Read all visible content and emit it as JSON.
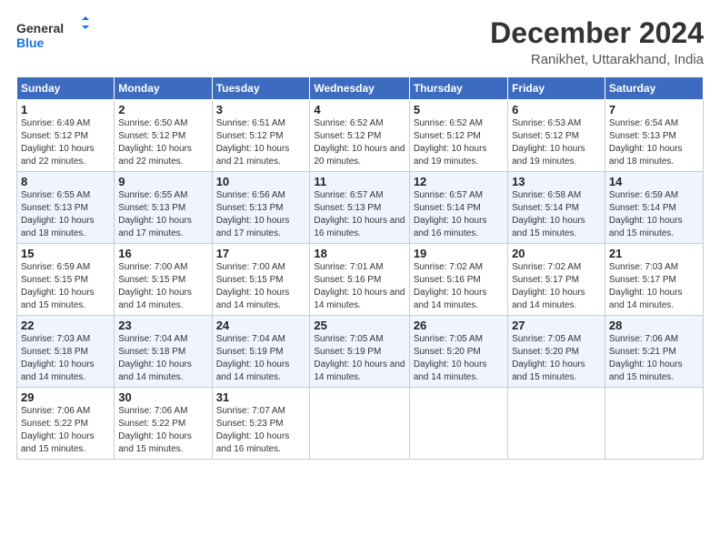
{
  "logo": {
    "line1": "General",
    "line2": "Blue"
  },
  "header": {
    "month": "December 2024",
    "location": "Ranikhet, Uttarakhand, India"
  },
  "weekdays": [
    "Sunday",
    "Monday",
    "Tuesday",
    "Wednesday",
    "Thursday",
    "Friday",
    "Saturday"
  ],
  "weeks": [
    [
      {
        "day": "1",
        "sunrise": "6:49 AM",
        "sunset": "5:12 PM",
        "daylight": "10 hours and 22 minutes."
      },
      {
        "day": "2",
        "sunrise": "6:50 AM",
        "sunset": "5:12 PM",
        "daylight": "10 hours and 22 minutes."
      },
      {
        "day": "3",
        "sunrise": "6:51 AM",
        "sunset": "5:12 PM",
        "daylight": "10 hours and 21 minutes."
      },
      {
        "day": "4",
        "sunrise": "6:52 AM",
        "sunset": "5:12 PM",
        "daylight": "10 hours and 20 minutes."
      },
      {
        "day": "5",
        "sunrise": "6:52 AM",
        "sunset": "5:12 PM",
        "daylight": "10 hours and 19 minutes."
      },
      {
        "day": "6",
        "sunrise": "6:53 AM",
        "sunset": "5:12 PM",
        "daylight": "10 hours and 19 minutes."
      },
      {
        "day": "7",
        "sunrise": "6:54 AM",
        "sunset": "5:13 PM",
        "daylight": "10 hours and 18 minutes."
      }
    ],
    [
      {
        "day": "8",
        "sunrise": "6:55 AM",
        "sunset": "5:13 PM",
        "daylight": "10 hours and 18 minutes."
      },
      {
        "day": "9",
        "sunrise": "6:55 AM",
        "sunset": "5:13 PM",
        "daylight": "10 hours and 17 minutes."
      },
      {
        "day": "10",
        "sunrise": "6:56 AM",
        "sunset": "5:13 PM",
        "daylight": "10 hours and 17 minutes."
      },
      {
        "day": "11",
        "sunrise": "6:57 AM",
        "sunset": "5:13 PM",
        "daylight": "10 hours and 16 minutes."
      },
      {
        "day": "12",
        "sunrise": "6:57 AM",
        "sunset": "5:14 PM",
        "daylight": "10 hours and 16 minutes."
      },
      {
        "day": "13",
        "sunrise": "6:58 AM",
        "sunset": "5:14 PM",
        "daylight": "10 hours and 15 minutes."
      },
      {
        "day": "14",
        "sunrise": "6:59 AM",
        "sunset": "5:14 PM",
        "daylight": "10 hours and 15 minutes."
      }
    ],
    [
      {
        "day": "15",
        "sunrise": "6:59 AM",
        "sunset": "5:15 PM",
        "daylight": "10 hours and 15 minutes."
      },
      {
        "day": "16",
        "sunrise": "7:00 AM",
        "sunset": "5:15 PM",
        "daylight": "10 hours and 14 minutes."
      },
      {
        "day": "17",
        "sunrise": "7:00 AM",
        "sunset": "5:15 PM",
        "daylight": "10 hours and 14 minutes."
      },
      {
        "day": "18",
        "sunrise": "7:01 AM",
        "sunset": "5:16 PM",
        "daylight": "10 hours and 14 minutes."
      },
      {
        "day": "19",
        "sunrise": "7:02 AM",
        "sunset": "5:16 PM",
        "daylight": "10 hours and 14 minutes."
      },
      {
        "day": "20",
        "sunrise": "7:02 AM",
        "sunset": "5:17 PM",
        "daylight": "10 hours and 14 minutes."
      },
      {
        "day": "21",
        "sunrise": "7:03 AM",
        "sunset": "5:17 PM",
        "daylight": "10 hours and 14 minutes."
      }
    ],
    [
      {
        "day": "22",
        "sunrise": "7:03 AM",
        "sunset": "5:18 PM",
        "daylight": "10 hours and 14 minutes."
      },
      {
        "day": "23",
        "sunrise": "7:04 AM",
        "sunset": "5:18 PM",
        "daylight": "10 hours and 14 minutes."
      },
      {
        "day": "24",
        "sunrise": "7:04 AM",
        "sunset": "5:19 PM",
        "daylight": "10 hours and 14 minutes."
      },
      {
        "day": "25",
        "sunrise": "7:05 AM",
        "sunset": "5:19 PM",
        "daylight": "10 hours and 14 minutes."
      },
      {
        "day": "26",
        "sunrise": "7:05 AM",
        "sunset": "5:20 PM",
        "daylight": "10 hours and 14 minutes."
      },
      {
        "day": "27",
        "sunrise": "7:05 AM",
        "sunset": "5:20 PM",
        "daylight": "10 hours and 15 minutes."
      },
      {
        "day": "28",
        "sunrise": "7:06 AM",
        "sunset": "5:21 PM",
        "daylight": "10 hours and 15 minutes."
      }
    ],
    [
      {
        "day": "29",
        "sunrise": "7:06 AM",
        "sunset": "5:22 PM",
        "daylight": "10 hours and 15 minutes."
      },
      {
        "day": "30",
        "sunrise": "7:06 AM",
        "sunset": "5:22 PM",
        "daylight": "10 hours and 15 minutes."
      },
      {
        "day": "31",
        "sunrise": "7:07 AM",
        "sunset": "5:23 PM",
        "daylight": "10 hours and 16 minutes."
      },
      null,
      null,
      null,
      null
    ]
  ]
}
